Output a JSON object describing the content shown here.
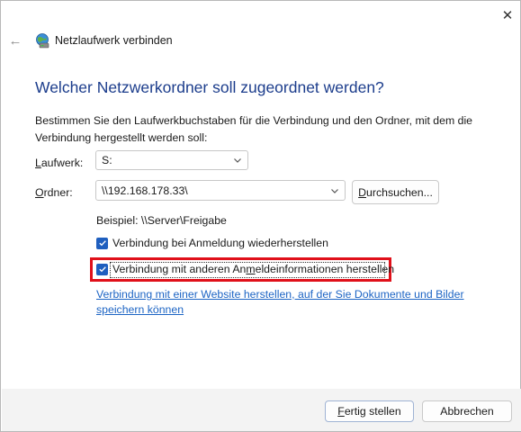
{
  "window": {
    "title": "Netzlaufwerk verbinden",
    "close_glyph": "✕",
    "back_glyph": "←"
  },
  "heading": "Welcher Netzwerkordner soll zugeordnet werden?",
  "description": "Bestimmen Sie den Laufwerkbuchstaben für die Verbindung und den Ordner, mit dem die Verbindung hergestellt werden soll:",
  "drive": {
    "label_hotkey": "L",
    "label_rest": "aufwerk:",
    "value": "S:"
  },
  "folder": {
    "label_hotkey": "O",
    "label_rest": "rdner:",
    "value": "\\\\192.168.178.33\\",
    "browse_hotkey": "D",
    "browse_rest": "urchsuchen..."
  },
  "example": "Beispiel: \\\\Server\\Freigabe",
  "checkboxes": {
    "reconnect": {
      "label": "Verbindung bei Anmeldung wiederherstellen",
      "checked": true
    },
    "credentials": {
      "label_before": "Verbindung mit anderen An",
      "label_hotkey": "m",
      "label_after": "eldeinformationen herstellen",
      "checked": true
    }
  },
  "website_link": "Verbindung mit einer Website herstellen, auf der Sie Dokumente und Bilder speichern können",
  "buttons": {
    "finish_hotkey": "F",
    "finish_rest": "ertig stellen",
    "cancel": "Abbrechen"
  },
  "colors": {
    "heading": "#1c3d8c",
    "accent": "#1f5fbf",
    "link": "#1c64c4",
    "highlight": "#e0101a"
  },
  "icons": {
    "window": "network-drive-icon",
    "close": "close-icon",
    "back": "back-arrow-icon",
    "chevron": "chevron-down-icon",
    "check": "checkmark-icon"
  }
}
